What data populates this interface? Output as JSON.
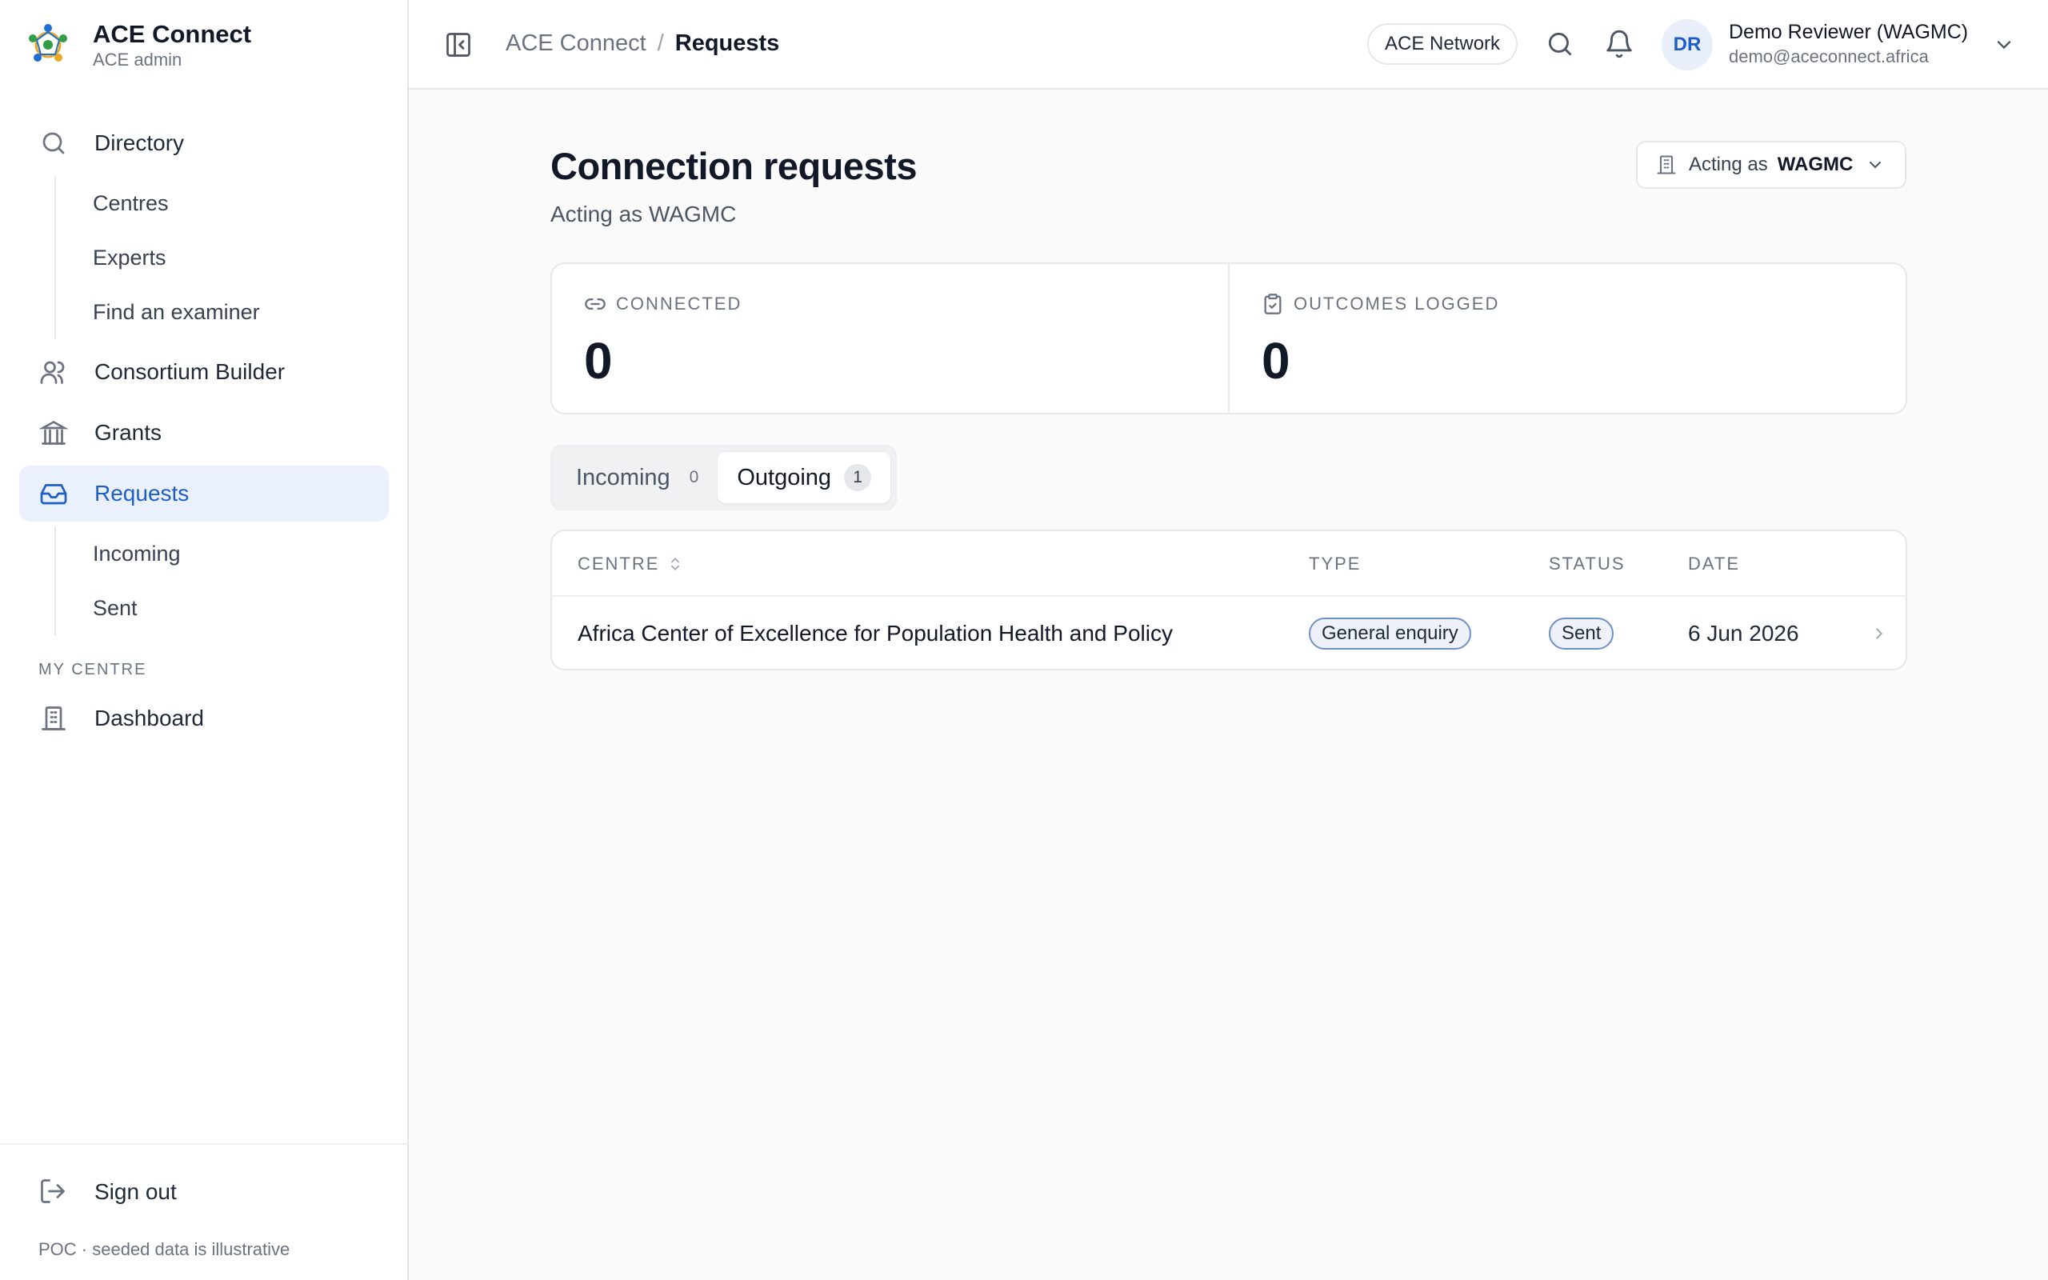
{
  "app": {
    "name": "ACE Connect",
    "role": "ACE admin"
  },
  "sidebar": {
    "items": [
      {
        "label": "Directory",
        "icon": "search-icon"
      },
      {
        "label": "Consortium Builder",
        "icon": "users-icon"
      },
      {
        "label": "Grants",
        "icon": "landmark-icon"
      },
      {
        "label": "Requests",
        "icon": "inbox-icon",
        "active": true
      }
    ],
    "directory_sub": [
      "Centres",
      "Experts",
      "Find an examiner"
    ],
    "requests_sub": [
      "Incoming",
      "Sent"
    ],
    "section_label": "MY CENTRE",
    "dashboard_label": "Dashboard",
    "signout_label": "Sign out",
    "footer_note": "POC · seeded data is illustrative"
  },
  "header": {
    "breadcrumb_root": "ACE Connect",
    "breadcrumb_sep": "/",
    "breadcrumb_current": "Requests",
    "network_pill": "ACE Network",
    "user_initials": "DR",
    "user_name": "Demo Reviewer (WAGMC)",
    "user_email": "demo@aceconnect.africa"
  },
  "main": {
    "title": "Connection requests",
    "subtitle": "Acting as WAGMC",
    "acting_label": "Acting as",
    "acting_value": "WAGMC",
    "stats": [
      {
        "label": "CONNECTED",
        "value": "0",
        "icon": "link-icon"
      },
      {
        "label": "OUTCOMES LOGGED",
        "value": "0",
        "icon": "clipboard-check-icon"
      }
    ],
    "tabs": [
      {
        "label": "Incoming",
        "count": "0"
      },
      {
        "label": "Outgoing",
        "count": "1",
        "active": true
      }
    ],
    "table": {
      "columns": [
        "CENTRE",
        "TYPE",
        "STATUS",
        "DATE"
      ],
      "rows": [
        {
          "centre": "Africa Center of Excellence for Population Health and Policy",
          "type": "General enquiry",
          "status": "Sent",
          "date": "6 Jun 2026"
        }
      ]
    }
  },
  "colors": {
    "accent": "#1d5fc6",
    "active_bg": "#eaf1fc",
    "badge_border": "#6f90c6"
  }
}
